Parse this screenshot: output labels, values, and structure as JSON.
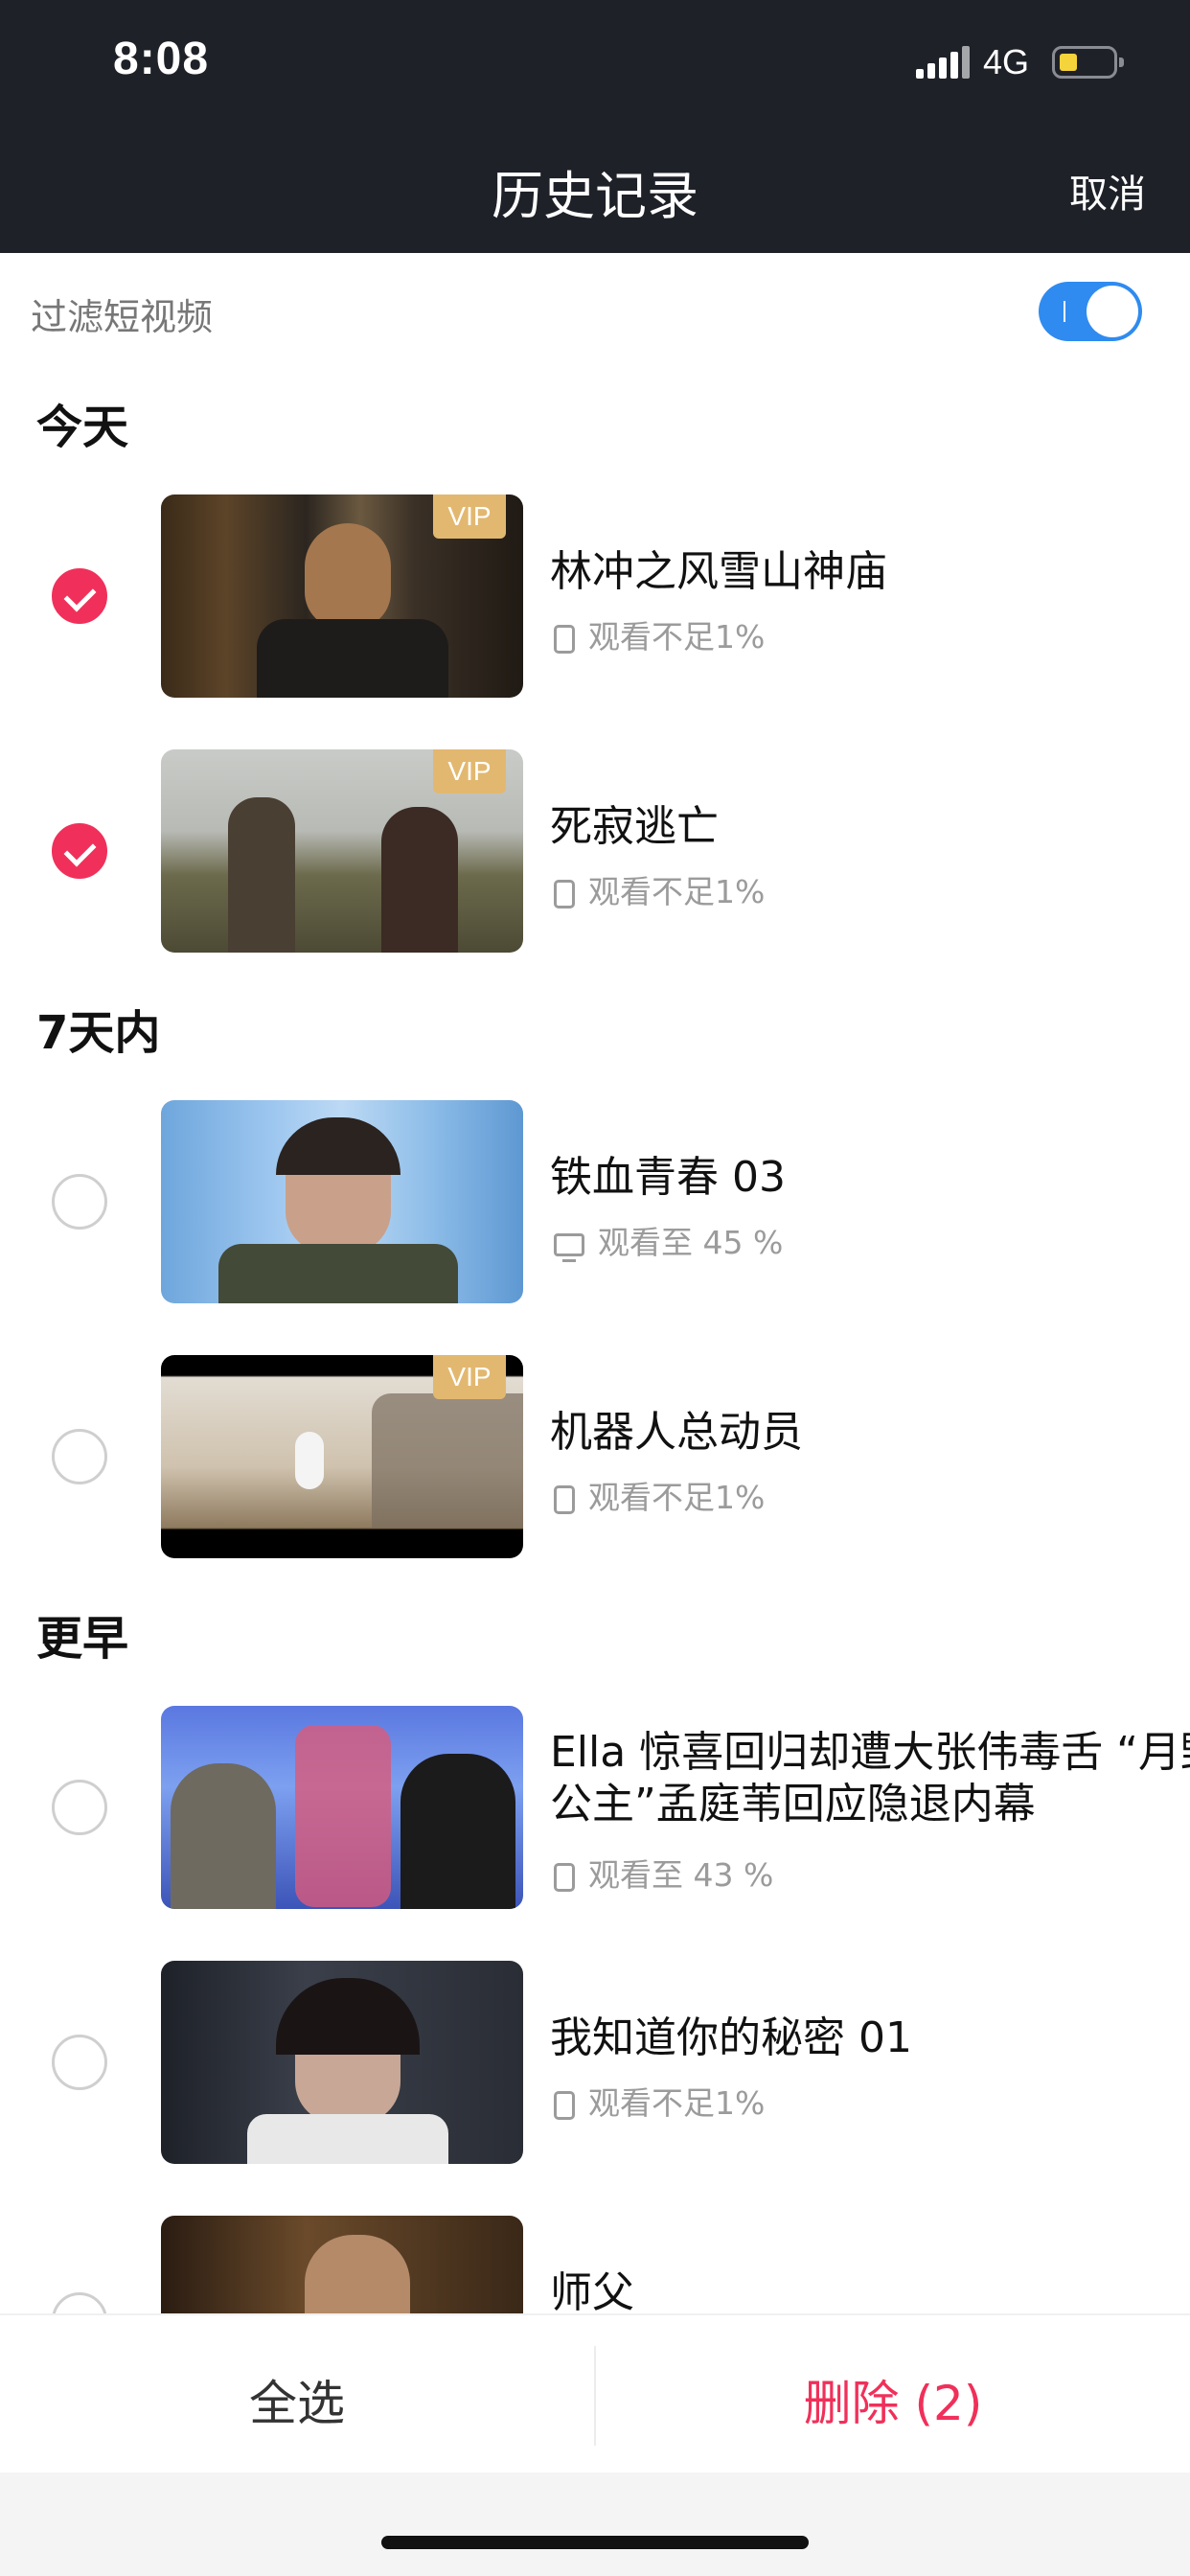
{
  "status_bar": {
    "time": "8:08",
    "network": "4G",
    "battery_level": 0.35,
    "battery_color": "#f5d33a"
  },
  "nav": {
    "title": "历史记录",
    "cancel_label": "取消"
  },
  "filter": {
    "label": "过滤短视频",
    "enabled": true
  },
  "sections": [
    {
      "title": "今天",
      "items": [
        {
          "title": "林冲之风雪山神庙",
          "progress": "观看不足1%",
          "device": "phone-icon",
          "vip": "VIP",
          "checked": true
        },
        {
          "title": "死寂逃亡",
          "progress": "观看不足1%",
          "device": "phone-icon",
          "vip": "VIP",
          "checked": true
        }
      ]
    },
    {
      "title": "7天内",
      "items": [
        {
          "title": "铁血青春 03",
          "progress": "观看至 45 %",
          "device": "tv-icon",
          "vip": "",
          "checked": false
        },
        {
          "title": "机器人总动员",
          "progress": "观看不足1%",
          "device": "phone-icon",
          "vip": "VIP",
          "checked": false
        }
      ]
    },
    {
      "title": "更早",
      "items": [
        {
          "title": "Ella 惊喜回归却遭大张伟毒舌 “月野公主”孟庭苇回应隐退内幕",
          "progress": "观看至 43 %",
          "device": "phone-icon",
          "vip": "",
          "checked": false
        },
        {
          "title": "我知道你的秘密 01",
          "progress": "观看不足1%",
          "device": "phone-icon",
          "vip": "",
          "checked": false
        },
        {
          "title": "师父",
          "progress": "",
          "device": "",
          "vip": "",
          "checked": false
        }
      ]
    }
  ],
  "bottom": {
    "select_all_label": "全选",
    "delete_label": "删除 (2)"
  },
  "colors": {
    "accent": "#f0305a",
    "toggle": "#2f8bf0",
    "vip": "#e2b870",
    "header": "#1f2129"
  }
}
